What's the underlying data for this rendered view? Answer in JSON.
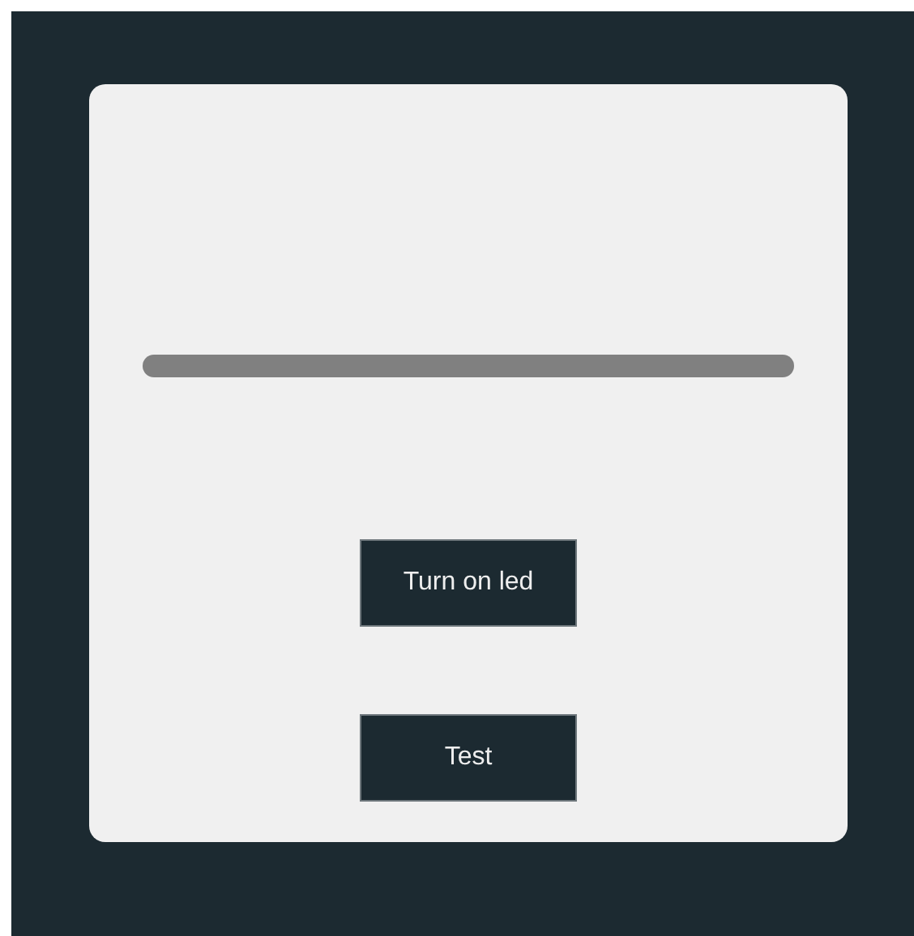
{
  "buttons": [
    {
      "label": "Turn on led"
    },
    {
      "label": "Test"
    }
  ]
}
